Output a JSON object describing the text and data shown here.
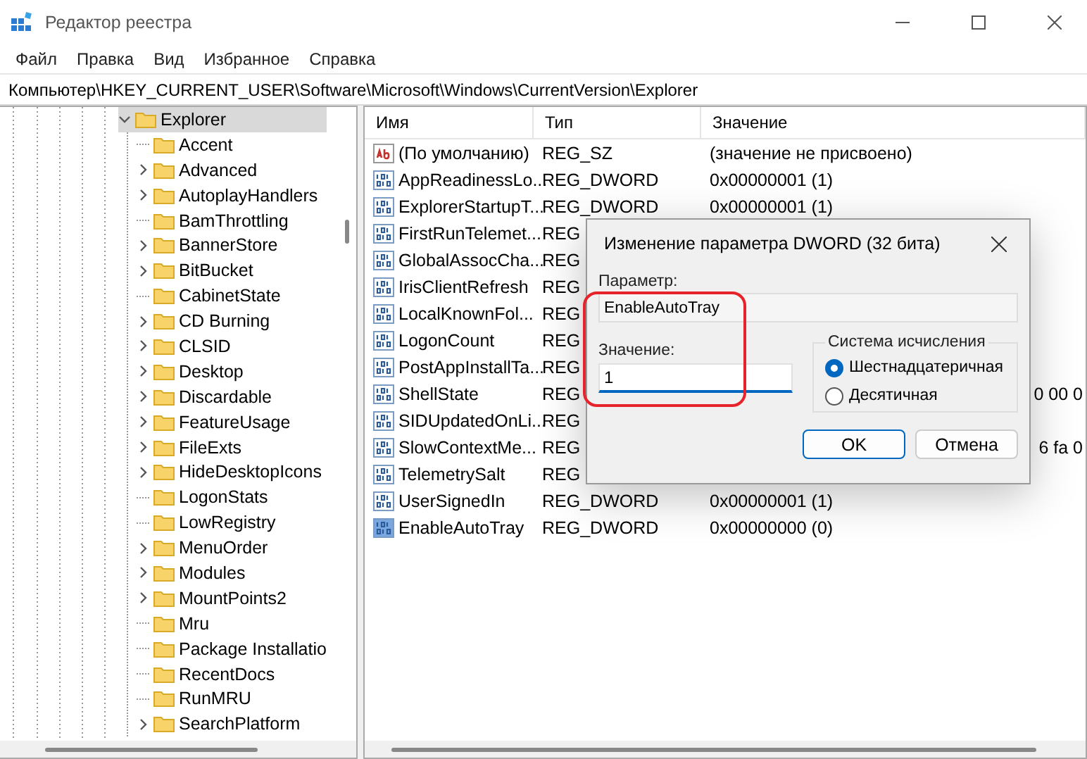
{
  "window": {
    "title": "Редактор реестра"
  },
  "menu": [
    "Файл",
    "Правка",
    "Вид",
    "Избранное",
    "Справка"
  ],
  "address": "Компьютер\\HKEY_CURRENT_USER\\Software\\Microsoft\\Windows\\CurrentVersion\\Explorer",
  "tree": {
    "label": "Explorer",
    "selected": true,
    "expanded": true,
    "children": [
      {
        "label": "Accent",
        "expandable": false
      },
      {
        "label": "Advanced",
        "expandable": true
      },
      {
        "label": "AutoplayHandlers",
        "expandable": true
      },
      {
        "label": "BamThrottling",
        "expandable": false
      },
      {
        "label": "BannerStore",
        "expandable": true
      },
      {
        "label": "BitBucket",
        "expandable": true
      },
      {
        "label": "CabinetState",
        "expandable": false
      },
      {
        "label": "CD Burning",
        "expandable": true
      },
      {
        "label": "CLSID",
        "expandable": true
      },
      {
        "label": "Desktop",
        "expandable": true
      },
      {
        "label": "Discardable",
        "expandable": true
      },
      {
        "label": "FeatureUsage",
        "expandable": true
      },
      {
        "label": "FileExts",
        "expandable": true
      },
      {
        "label": "HideDesktopIcons",
        "expandable": true
      },
      {
        "label": "LogonStats",
        "expandable": false
      },
      {
        "label": "LowRegistry",
        "expandable": false
      },
      {
        "label": "MenuOrder",
        "expandable": true
      },
      {
        "label": "Modules",
        "expandable": true
      },
      {
        "label": "MountPoints2",
        "expandable": true
      },
      {
        "label": "Mru",
        "expandable": false
      },
      {
        "label": "Package Installatio",
        "expandable": false
      },
      {
        "label": "RecentDocs",
        "expandable": false
      },
      {
        "label": "RunMRU",
        "expandable": false
      },
      {
        "label": "SearchPlatform",
        "expandable": true
      }
    ]
  },
  "table": {
    "columns": [
      "Имя",
      "Тип",
      "Значение"
    ],
    "rows": [
      {
        "kind": "string",
        "name": "(По умолчанию)",
        "type": "REG_SZ",
        "value": "(значение не присвоено)",
        "selected": false
      },
      {
        "kind": "binary",
        "name": "AppReadinessLo...",
        "type": "REG_DWORD",
        "value": "0x00000001 (1)",
        "selected": false
      },
      {
        "kind": "binary",
        "name": "ExplorerStartupT...",
        "type": "REG_DWORD",
        "value": "0x00000001 (1)",
        "selected": false
      },
      {
        "kind": "binary",
        "name": "FirstRunTelemet...",
        "type": "REG",
        "selected": false
      },
      {
        "kind": "binary",
        "name": "GlobalAssocCha...",
        "type": "REG",
        "selected": false
      },
      {
        "kind": "binary",
        "name": "IrisClientRefresh",
        "type": "REG",
        "selected": false
      },
      {
        "kind": "binary",
        "name": "LocalKnownFol...",
        "type": "REG",
        "selected": false
      },
      {
        "kind": "binary",
        "name": "LogonCount",
        "type": "REG",
        "selected": false
      },
      {
        "kind": "binary",
        "name": "PostAppInstallTa...",
        "type": "REG",
        "selected": false
      },
      {
        "kind": "binary",
        "name": "ShellState",
        "type": "REG",
        "value_tail": "0 00 0",
        "selected": false
      },
      {
        "kind": "binary",
        "name": "SIDUpdatedOnLi...",
        "type": "REG",
        "selected": false
      },
      {
        "kind": "binary",
        "name": "SlowContextMe...",
        "type": "REG",
        "value_tail": "6 fa 0",
        "selected": false
      },
      {
        "kind": "binary",
        "name": "TelemetrySalt",
        "type": "REG",
        "selected": false
      },
      {
        "kind": "binary",
        "name": "UserSignedIn",
        "type": "REG_DWORD",
        "value": "0x00000001 (1)",
        "selected": false
      },
      {
        "kind": "binary",
        "name": "EnableAutoTray",
        "type": "REG_DWORD",
        "value": "0x00000000 (0)",
        "selected": true
      }
    ]
  },
  "dialog": {
    "title": "Изменение параметра DWORD (32 бита)",
    "name_label": "Параметр:",
    "name_value": "EnableAutoTray",
    "value_label": "Значение:",
    "value": "1",
    "base_group": {
      "title": "Система исчисления",
      "options": [
        {
          "label": "Шестнадцатеричная",
          "selected": true
        },
        {
          "label": "Десятичная",
          "selected": false
        }
      ]
    },
    "buttons": [
      {
        "label": "OK",
        "default": true
      },
      {
        "label": "Отмена",
        "default": false
      }
    ]
  }
}
